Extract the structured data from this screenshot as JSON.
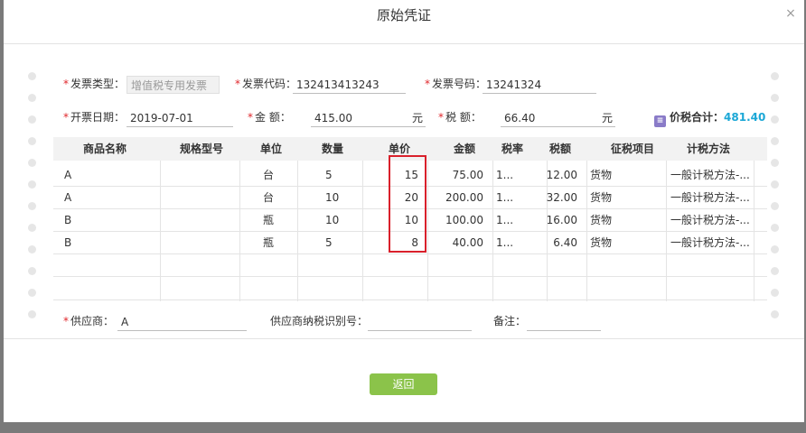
{
  "dialog": {
    "title": "原始凭证",
    "close_label": "×",
    "return_label": "返回"
  },
  "header": {
    "invoice_type_label": "发票类型：",
    "invoice_type_value": "增值税专用发票",
    "invoice_code_label": "发票代码：",
    "invoice_code_value": "132413413243",
    "invoice_no_label": "发票号码：",
    "invoice_no_value": "13241324",
    "date_label": "开票日期：",
    "date_value": "2019-07-01",
    "amount_label": "金        额：",
    "amount_value": "415.00",
    "amount_unit": "元",
    "tax_label": "税        额：",
    "tax_value": "66.40",
    "tax_unit": "元",
    "total_label": "价税合计：",
    "total_value": "481.40"
  },
  "table": {
    "columns": [
      "商品名称",
      "规格型号",
      "单位",
      "数量",
      "单价",
      "金额",
      "税率",
      "税额",
      "征税项目",
      "计税方法"
    ],
    "rows": [
      [
        "A",
        "",
        "台",
        "5",
        "15",
        "75.00",
        "1...",
        "12.00",
        "货物",
        "一般计税方法-..."
      ],
      [
        "A",
        "",
        "台",
        "10",
        "20",
        "200.00",
        "1...",
        "32.00",
        "货物",
        "一般计税方法-..."
      ],
      [
        "B",
        "",
        "瓶",
        "10",
        "10",
        "100.00",
        "1...",
        "16.00",
        "货物",
        "一般计税方法-..."
      ],
      [
        "B",
        "",
        "瓶",
        "5",
        "8",
        "40.00",
        "1...",
        "6.40",
        "货物",
        "一般计税方法-..."
      ]
    ]
  },
  "footer": {
    "supplier_label": "供应商：",
    "supplier_value": "A",
    "taxid_label": "供应商纳税识别号：",
    "taxid_value": "",
    "remark_label": "备注：",
    "remark_value": ""
  },
  "colors": {
    "required": "#e0262b",
    "total_value": "#1ba7d6",
    "button": "#8bc34a",
    "highlight": "#d9202b"
  }
}
